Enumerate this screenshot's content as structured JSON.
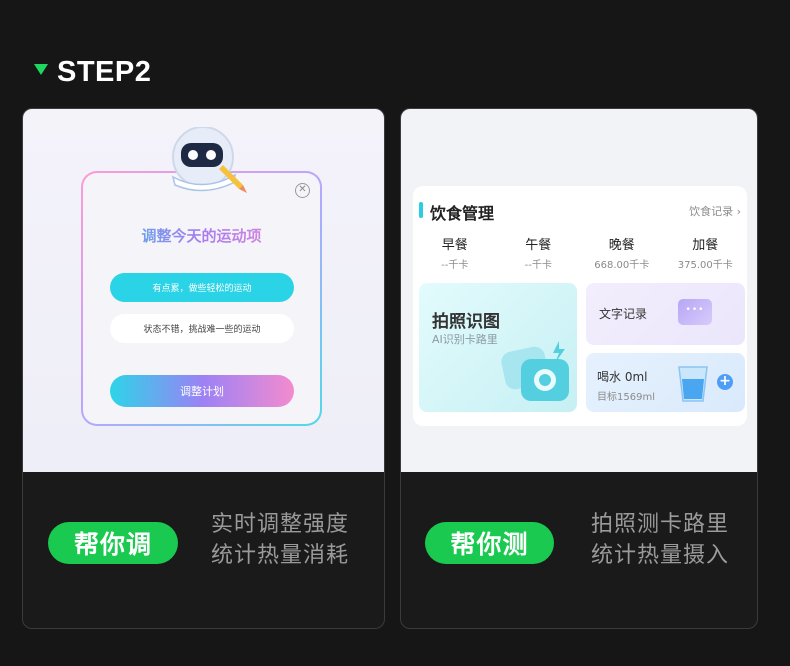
{
  "header": {
    "step_label": "STEP2",
    "accent": "#1ed760"
  },
  "left_card": {
    "popup": {
      "title": "调整今天的运动项",
      "option_easy": "有点累，做些轻松的运动",
      "option_hard": "状态不错，挑战难一些的运动",
      "button": "调整计划"
    },
    "badge": "帮你调",
    "description": [
      "实时调整强度",
      "统计热量消耗"
    ]
  },
  "right_card": {
    "diet": {
      "title": "饮食管理",
      "record_link": "饮食记录",
      "meals": [
        {
          "name": "早餐",
          "value": "--千卡"
        },
        {
          "name": "午餐",
          "value": "--千卡"
        },
        {
          "name": "晚餐",
          "value": "668.00千卡"
        },
        {
          "name": "加餐",
          "value": "375.00千卡"
        }
      ],
      "photo": {
        "title": "拍照识图",
        "subtitle": "AI识别卡路里"
      },
      "text_record": {
        "title": "文字记录"
      },
      "water": {
        "title": "喝水 0ml",
        "goal": "目标1569ml"
      }
    },
    "badge": "帮你测",
    "description": [
      "拍照测卡路里",
      "统计热量摄入"
    ]
  },
  "colors": {
    "badge_green": "#1ac94f",
    "page_bg": "#161616"
  }
}
